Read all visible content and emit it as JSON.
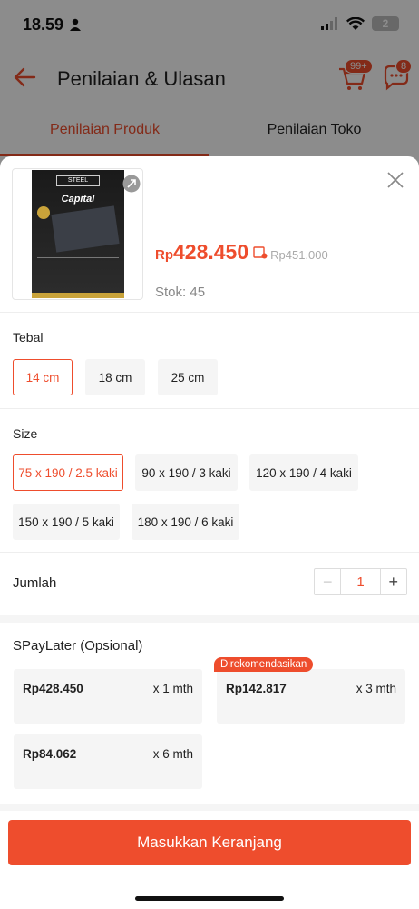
{
  "status_bar": {
    "time": "18.59",
    "battery": "2"
  },
  "header": {
    "title": "Penilaian & Ulasan",
    "cart_badge": "99+",
    "chat_badge": "8"
  },
  "tabs": [
    {
      "label": "Penilaian Produk"
    },
    {
      "label": "Penilaian Toko"
    }
  ],
  "product": {
    "image_brand": "STEEL",
    "image_name": "Capital",
    "price_currency": "Rp",
    "price": "428.450",
    "original_price": "Rp451.000",
    "stock": "Stok: 45"
  },
  "tebal": {
    "title": "Tebal",
    "options": [
      "14 cm",
      "18 cm",
      "25 cm"
    ],
    "selected": "14 cm"
  },
  "size": {
    "title": "Size",
    "options": [
      "75 x 190 / 2.5 kaki",
      "90 x 190 / 3 kaki",
      "120 x 190 / 4 kaki",
      "150 x 190 / 5 kaki",
      "180 x 190 / 6 kaki"
    ],
    "selected": "75 x 190 / 2.5 kaki"
  },
  "quantity": {
    "label": "Jumlah",
    "value": "1",
    "minus": "−",
    "plus": "+"
  },
  "spaylater": {
    "title": "SPayLater (Opsional)",
    "plans": [
      {
        "amount": "Rp428.450",
        "term": "x 1 mth"
      },
      {
        "amount": "Rp142.817",
        "term": "x 3 mth",
        "badge": "Direkomendasikan"
      },
      {
        "amount": "Rp84.062",
        "term": "x 6 mth"
      }
    ]
  },
  "cta": {
    "label": "Masukkan Keranjang"
  },
  "colors": {
    "accent": "#ee4d2d",
    "option_bg": "#f5f5f5"
  }
}
